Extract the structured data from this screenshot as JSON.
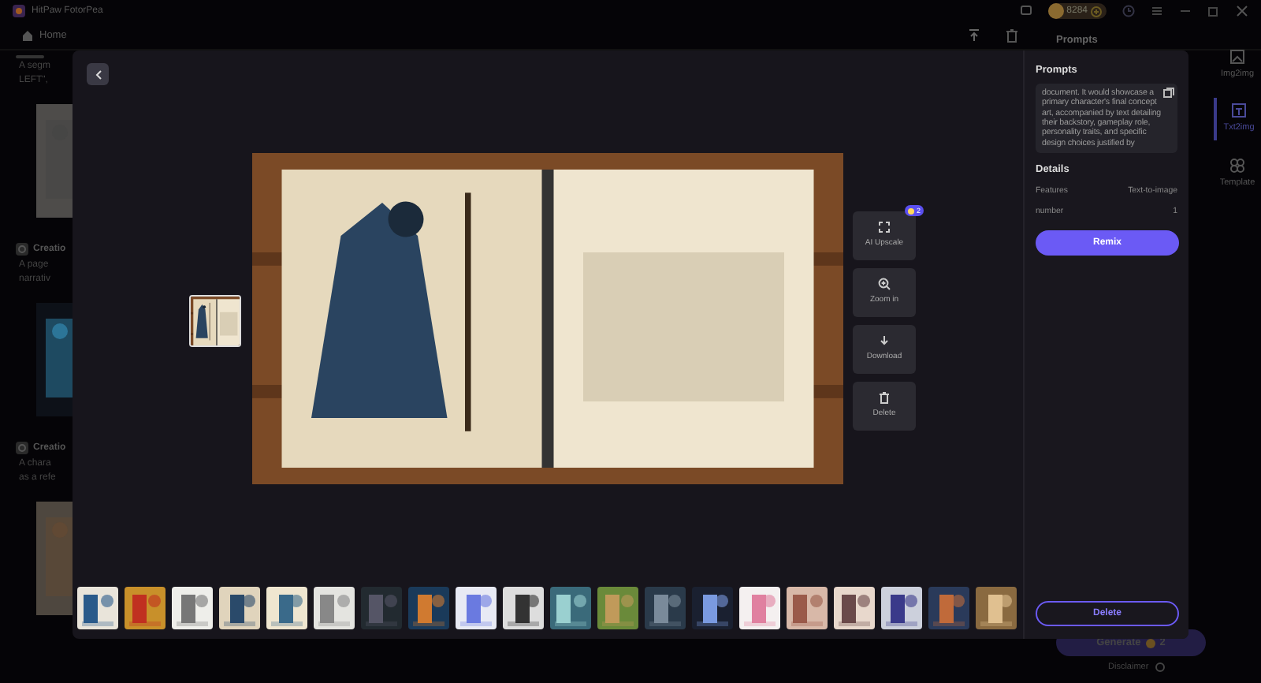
{
  "app": {
    "title": "HitPaw FotorPea",
    "credits": "8284",
    "nav": "Home"
  },
  "feed": [
    {
      "lines": [
        "A segm",
        "LEFT\","
      ]
    },
    {
      "title": "Creatio",
      "lines": [
        "A page",
        "narrativ"
      ]
    },
    {
      "title": "Creatio",
      "lines": [
        "A chara",
        "as a refe"
      ]
    }
  ],
  "side_panel": {
    "heading": "Prompts",
    "generate": "Generate",
    "cost": "2",
    "disclaimer": "Disclaimer"
  },
  "right_nav": [
    {
      "label": "Img2img",
      "selected": false
    },
    {
      "label": "Txt2img",
      "selected": true
    },
    {
      "label": "Template",
      "selected": false
    }
  ],
  "viewer": {
    "actions": [
      {
        "kind": "upscale",
        "label": "AI Upscale",
        "badge": "2"
      },
      {
        "kind": "zoom",
        "label": "Zoom in"
      },
      {
        "kind": "download",
        "label": "Download"
      },
      {
        "kind": "delete",
        "label": "Delete"
      }
    ],
    "prompts_title": "Prompts",
    "prompt": "document. It would showcase a primary character's final concept art, accompanied by text detailing their backstory, gameplay role, personality traits, and specific design choices justified by",
    "details_title": "Details",
    "details": [
      {
        "label": "Features",
        "value": "Text-to-image"
      },
      {
        "label": "number",
        "value": "1"
      }
    ],
    "remix": "Remix",
    "delete": "Delete"
  }
}
